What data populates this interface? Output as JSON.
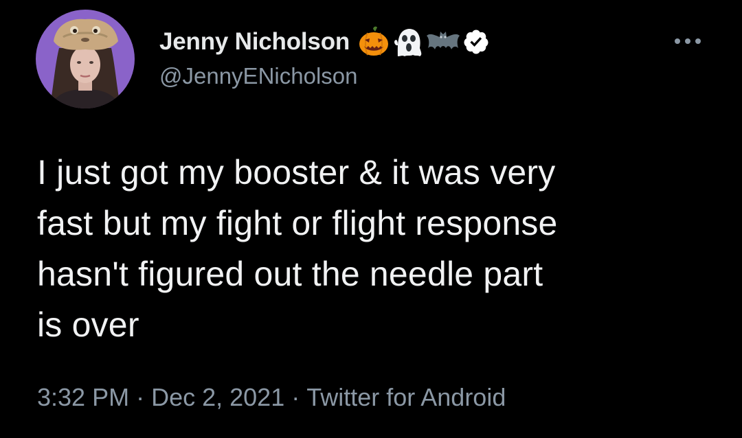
{
  "author": {
    "display_name": "Jenny Nicholson",
    "handle": "@JennyENicholson",
    "name_emojis": [
      "jack-o-lantern-icon",
      "ghost-icon",
      "bat-icon"
    ],
    "verified": true
  },
  "tweet": {
    "lines": [
      "I just got my booster & it was very",
      "fast but my fight or flight response",
      "hasn't figured out the needle part",
      "is over"
    ]
  },
  "meta": {
    "time": "3:32 PM",
    "date": "Dec 2, 2021",
    "separator": "·",
    "source": "Twitter for Android"
  },
  "colors": {
    "background": "#000000",
    "primary_text": "#e7e9ea",
    "secondary_text": "#8b98a5",
    "avatar_bg": "#8a63c9"
  }
}
